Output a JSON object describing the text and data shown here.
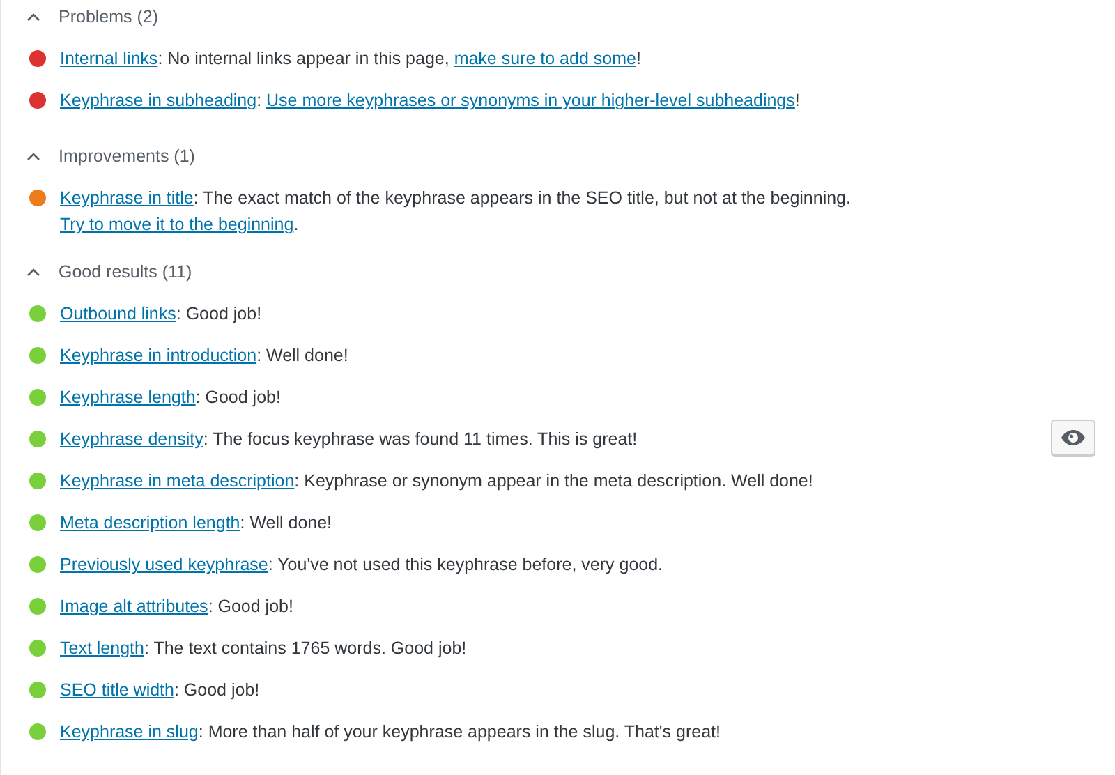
{
  "sections": [
    {
      "title": "Problems (2)",
      "expanded": true,
      "items": [
        {
          "color": "#dc3232",
          "eye_button": false,
          "parts": [
            {
              "text": "Internal links",
              "link": true
            },
            {
              "text": ": No internal links appear in this page, ",
              "link": false
            },
            {
              "text": "make sure to add some",
              "link": true
            },
            {
              "text": "!",
              "link": false
            }
          ]
        },
        {
          "color": "#dc3232",
          "eye_button": false,
          "parts": [
            {
              "text": "Keyphrase in subheading",
              "link": true
            },
            {
              "text": ": ",
              "link": false
            },
            {
              "text": "Use more keyphrases or synonyms in your higher-level subheadings",
              "link": true
            },
            {
              "text": "!",
              "link": false
            }
          ]
        }
      ]
    },
    {
      "title": "Improvements (1)",
      "expanded": true,
      "items": [
        {
          "color": "#ee7c1b",
          "eye_button": false,
          "parts": [
            {
              "text": "Keyphrase in title",
              "link": true
            },
            {
              "text": ": The exact match of the keyphrase appears in the SEO title, but not at the beginning. ",
              "link": false
            },
            {
              "text": "Try to move it to the beginning",
              "link": true
            },
            {
              "text": ".",
              "link": false
            }
          ]
        }
      ]
    },
    {
      "title": "Good results (11)",
      "expanded": true,
      "items": [
        {
          "color": "#7ad03a",
          "eye_button": false,
          "parts": [
            {
              "text": "Outbound links",
              "link": true
            },
            {
              "text": ": Good job!",
              "link": false
            }
          ]
        },
        {
          "color": "#7ad03a",
          "eye_button": false,
          "parts": [
            {
              "text": "Keyphrase in introduction",
              "link": true
            },
            {
              "text": ": Well done!",
              "link": false
            }
          ]
        },
        {
          "color": "#7ad03a",
          "eye_button": false,
          "parts": [
            {
              "text": "Keyphrase length",
              "link": true
            },
            {
              "text": ": Good job!",
              "link": false
            }
          ]
        },
        {
          "color": "#7ad03a",
          "eye_button": true,
          "parts": [
            {
              "text": "Keyphrase density",
              "link": true
            },
            {
              "text": ": The focus keyphrase was found 11 times. This is great!",
              "link": false
            }
          ]
        },
        {
          "color": "#7ad03a",
          "eye_button": false,
          "parts": [
            {
              "text": "Keyphrase in meta description",
              "link": true
            },
            {
              "text": ": Keyphrase or synonym appear in the meta description. Well done!",
              "link": false
            }
          ]
        },
        {
          "color": "#7ad03a",
          "eye_button": false,
          "parts": [
            {
              "text": "Meta description length",
              "link": true
            },
            {
              "text": ": Well done!",
              "link": false
            }
          ]
        },
        {
          "color": "#7ad03a",
          "eye_button": false,
          "parts": [
            {
              "text": "Previously used keyphrase",
              "link": true
            },
            {
              "text": ": You've not used this keyphrase before, very good.",
              "link": false
            }
          ]
        },
        {
          "color": "#7ad03a",
          "eye_button": false,
          "parts": [
            {
              "text": "Image alt attributes",
              "link": true
            },
            {
              "text": ": Good job!",
              "link": false
            }
          ]
        },
        {
          "color": "#7ad03a",
          "eye_button": false,
          "parts": [
            {
              "text": "Text length",
              "link": true
            },
            {
              "text": ": The text contains 1765 words. Good job!",
              "link": false
            }
          ]
        },
        {
          "color": "#7ad03a",
          "eye_button": false,
          "parts": [
            {
              "text": "SEO title width",
              "link": true
            },
            {
              "text": ": Good job!",
              "link": false
            }
          ]
        },
        {
          "color": "#7ad03a",
          "eye_button": false,
          "parts": [
            {
              "text": "Keyphrase in slug",
              "link": true
            },
            {
              "text": ": More than half of your keyphrase appears in the slug. That's great!",
              "link": false
            }
          ]
        }
      ]
    }
  ]
}
